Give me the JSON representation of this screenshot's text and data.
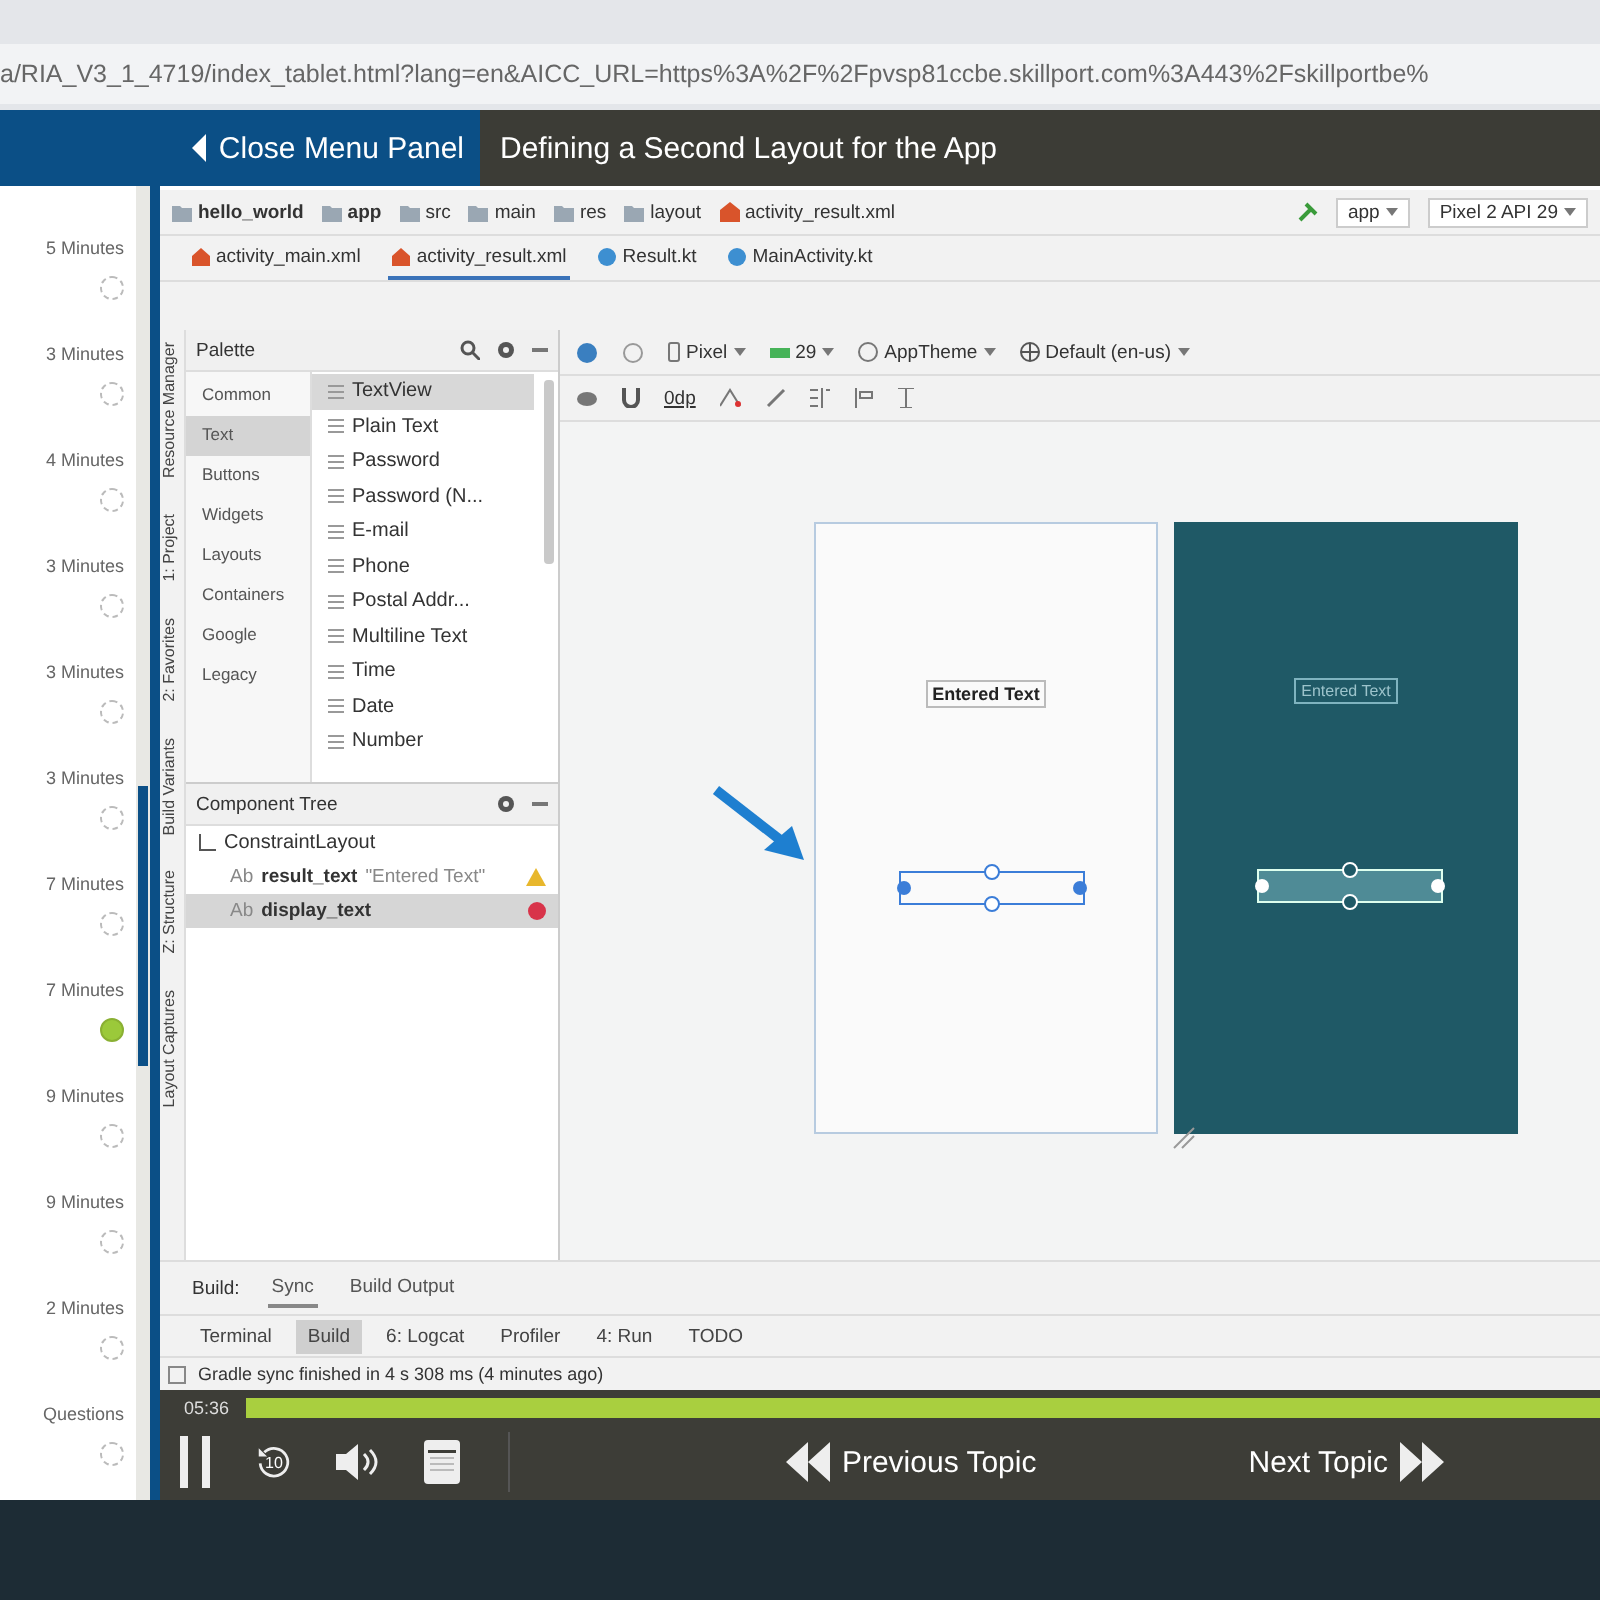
{
  "browser": {
    "url": "a/RIA_V3_1_4719/index_tablet.html?lang=en&AICC_URL=https%3A%2F%2Fpvsp81ccbe.skillport.com%3A443%2Fskillportbe%"
  },
  "header": {
    "close_button": "Close Menu Panel",
    "title": "Defining a Second Layout for the App"
  },
  "sidebar": {
    "items": [
      {
        "duration": "5 Minutes",
        "selected": false
      },
      {
        "duration": "3 Minutes",
        "selected": false
      },
      {
        "duration": "4 Minutes",
        "selected": false
      },
      {
        "duration": "3 Minutes",
        "selected": false
      },
      {
        "duration": "3 Minutes",
        "selected": false
      },
      {
        "duration": "3 Minutes",
        "selected": false
      },
      {
        "duration": "7 Minutes",
        "selected": false
      },
      {
        "duration": "7 Minutes",
        "selected": true
      },
      {
        "duration": "9 Minutes",
        "selected": false
      },
      {
        "duration": "9 Minutes",
        "selected": false
      },
      {
        "duration": "2 Minutes",
        "selected": false
      },
      {
        "duration": "Questions",
        "selected": false
      }
    ]
  },
  "ide": {
    "breadcrumbs": [
      "hello_world",
      "app",
      "src",
      "main",
      "res",
      "layout",
      "activity_result.xml"
    ],
    "run_config": "app",
    "device": "Pixel 2 API 29",
    "tabs": [
      {
        "label": "activity_main.xml",
        "selected": false
      },
      {
        "label": "activity_result.xml",
        "selected": true
      },
      {
        "label": "Result.kt",
        "selected": false
      },
      {
        "label": "MainActivity.kt",
        "selected": false
      }
    ],
    "side_tools": [
      "Resource Manager",
      "1: Project",
      "2: Favorites",
      "Build Variants",
      "Z: Structure",
      "Layout Captures"
    ],
    "palette": {
      "title": "Palette",
      "categories": [
        {
          "label": "Common",
          "selected": false
        },
        {
          "label": "Text",
          "selected": true
        },
        {
          "label": "Buttons",
          "selected": false
        },
        {
          "label": "Widgets",
          "selected": false
        },
        {
          "label": "Layouts",
          "selected": false
        },
        {
          "label": "Containers",
          "selected": false
        },
        {
          "label": "Google",
          "selected": false
        },
        {
          "label": "Legacy",
          "selected": false
        }
      ],
      "items": [
        {
          "label": "TextView",
          "selected": true
        },
        {
          "label": "Plain Text",
          "selected": false
        },
        {
          "label": "Password",
          "selected": false
        },
        {
          "label": "Password (N...",
          "selected": false
        },
        {
          "label": "E-mail",
          "selected": false
        },
        {
          "label": "Phone",
          "selected": false
        },
        {
          "label": "Postal Addr...",
          "selected": false
        },
        {
          "label": "Multiline Text",
          "selected": false
        },
        {
          "label": "Time",
          "selected": false
        },
        {
          "label": "Date",
          "selected": false
        },
        {
          "label": "Number",
          "selected": false
        }
      ]
    },
    "component_tree": {
      "title": "Component Tree",
      "root": {
        "label": "ConstraintLayout",
        "children": [
          {
            "icon_text": "Ab",
            "label": "result_text",
            "value": "\"Entered Text\"",
            "kind": "warning",
            "selected": false
          },
          {
            "icon_text": "Ab",
            "label": "display_text",
            "kind": "error",
            "selected": true
          }
        ]
      }
    },
    "design_toolbar": {
      "device": "Pixel",
      "api": "29",
      "theme": "AppTheme",
      "locale": "Default (en-us)",
      "margin": "0dp"
    },
    "design_preview": {
      "label": "Entered Text"
    },
    "blueprint": {
      "label": "Entered Text"
    },
    "build_bar": {
      "title": "Build:",
      "tabs": [
        {
          "label": "Sync",
          "selected": true
        },
        {
          "label": "Build Output",
          "selected": false
        }
      ]
    },
    "tool_windows": [
      {
        "label": "Terminal",
        "selected": false
      },
      {
        "label": "Build",
        "selected": true
      },
      {
        "label": "6: Logcat",
        "selected": false
      },
      {
        "label": "Profiler",
        "selected": false
      },
      {
        "label": "4: Run",
        "selected": false
      },
      {
        "label": "TODO",
        "selected": false
      }
    ],
    "status": "Gradle sync finished in 4 s 308 ms (4 minutes ago)"
  },
  "player": {
    "time": "05:36",
    "level": 1,
    "replay_seconds": "10",
    "previous": "Previous Topic",
    "next": "Next Topic"
  }
}
